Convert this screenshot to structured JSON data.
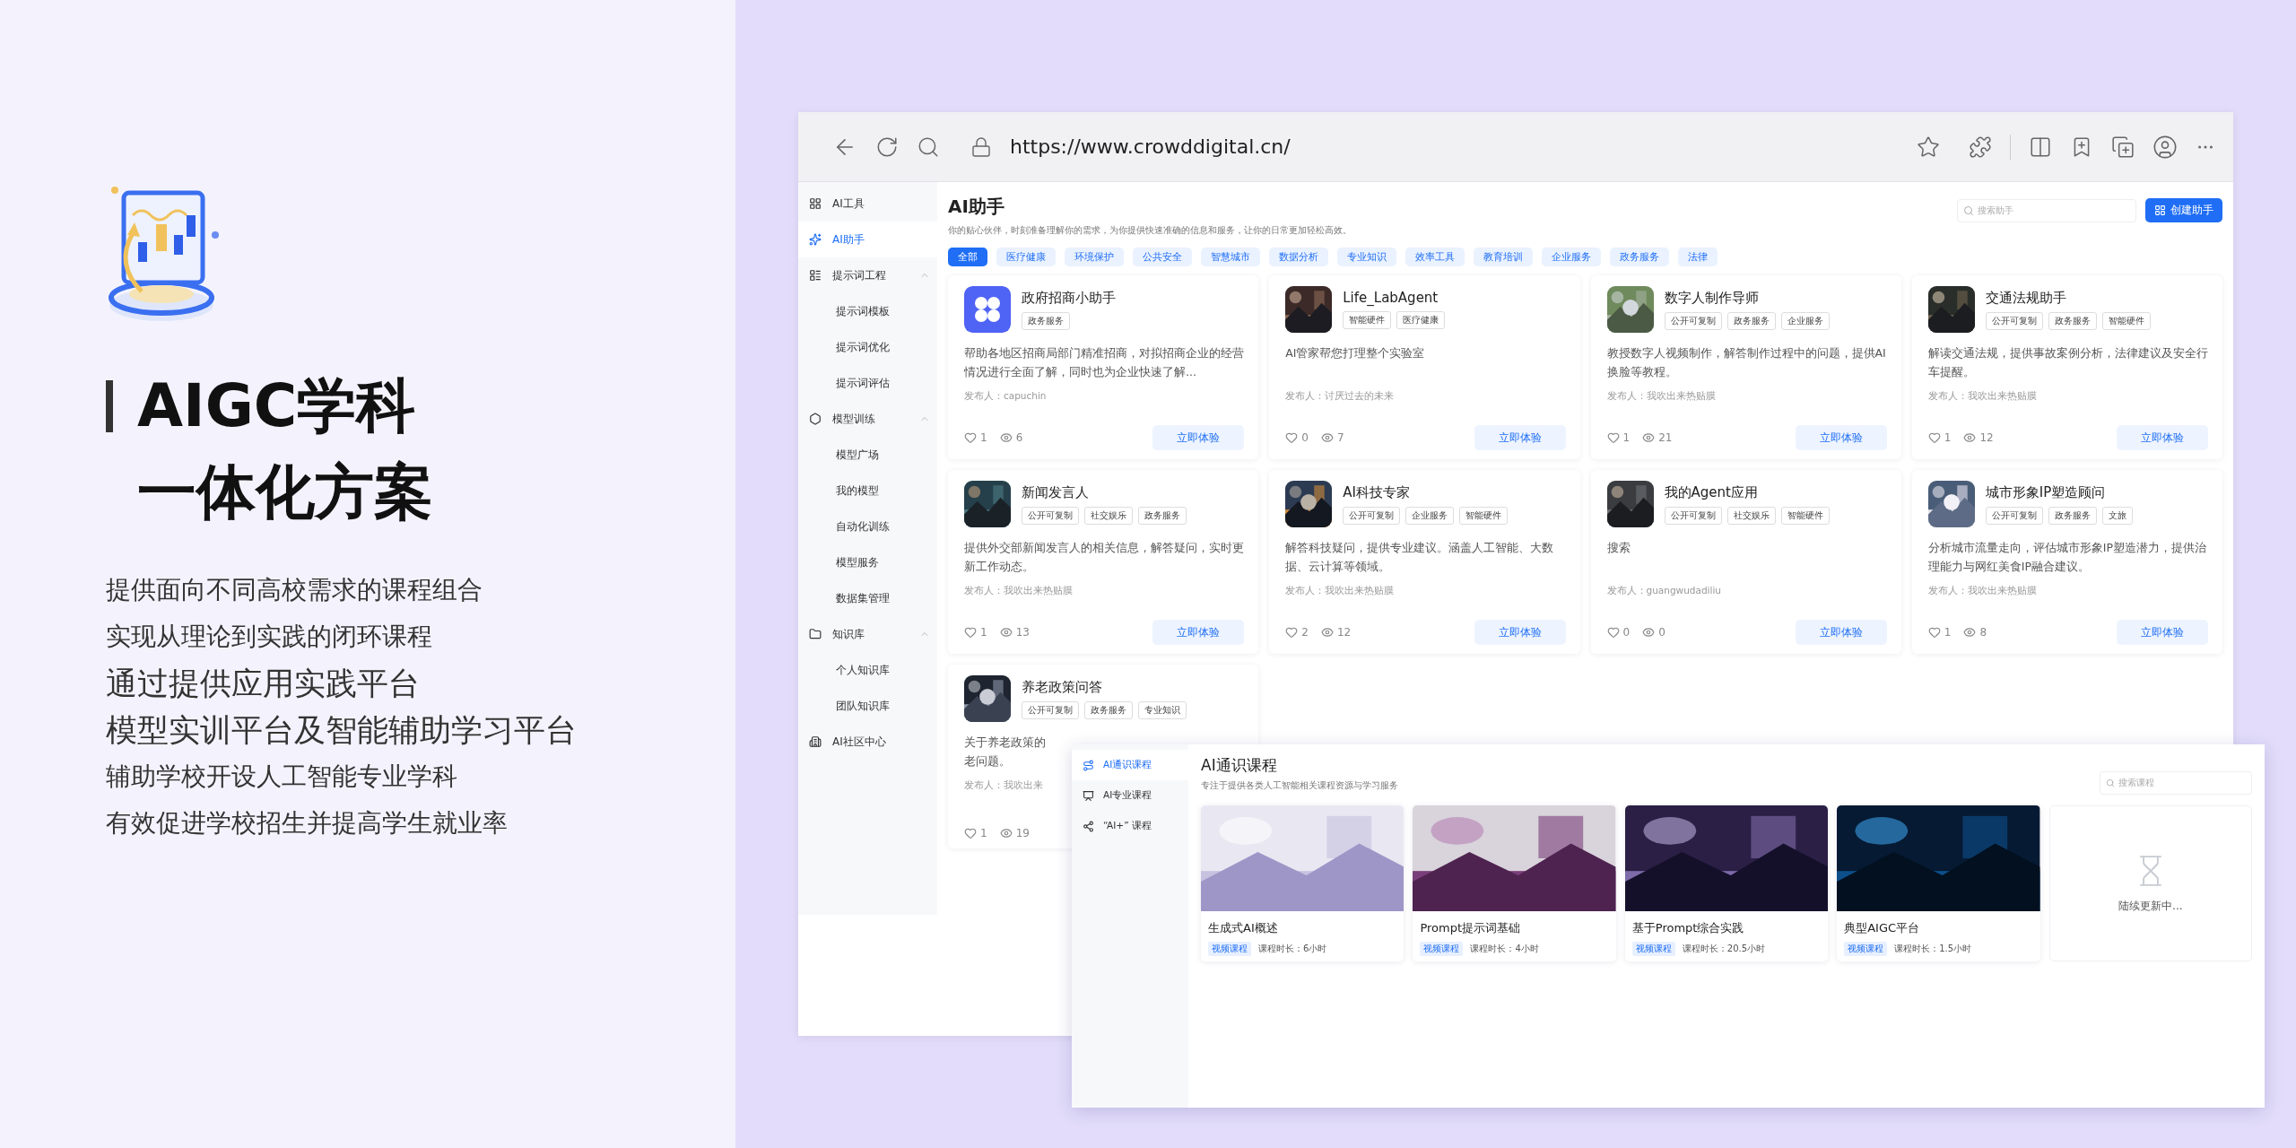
{
  "hero": {
    "title_lines": [
      "AIGC学科",
      "一体化方案"
    ],
    "bullets": [
      {
        "text": "提供面向不同高校需求的课程组合",
        "kind": "small"
      },
      {
        "text": "实现从理论到实践的闭环课程",
        "kind": "small"
      },
      {
        "text": "通过提供应用实践平台",
        "kind": "large"
      },
      {
        "text": "模型实训平台及智能辅助学习平台",
        "kind": "large"
      },
      {
        "text": "辅助学校开设人工智能专业学科",
        "kind": "small"
      },
      {
        "text": "有效促进学校招生并提高学生就业率",
        "kind": "small"
      }
    ]
  },
  "browser": {
    "url": "https://www.crowddigital.cn/"
  },
  "sidebar": {
    "items": [
      {
        "label": "AI工具",
        "selected": false
      },
      {
        "label": "AI助手",
        "selected": true
      },
      {
        "label": "提示词工程",
        "selected": false,
        "expanded": true,
        "children": [
          {
            "label": "提示词模板",
            "selected": false
          },
          {
            "label": "提示词优化",
            "selected": false
          },
          {
            "label": "提示词评估",
            "selected": false
          }
        ]
      },
      {
        "label": "模型训练",
        "selected": false,
        "expanded": true,
        "children": [
          {
            "label": "模型广场",
            "selected": false
          },
          {
            "label": "我的模型",
            "selected": false
          },
          {
            "label": "自动化训练",
            "selected": false
          },
          {
            "label": "模型服务",
            "selected": false
          },
          {
            "label": "数据集管理",
            "selected": false
          }
        ]
      },
      {
        "label": "知识库",
        "selected": false,
        "expanded": true,
        "children": [
          {
            "label": "个人知识库",
            "selected": false
          },
          {
            "label": "团队知识库",
            "selected": false
          }
        ]
      },
      {
        "label": "AI社区中心",
        "selected": false
      }
    ]
  },
  "page": {
    "title": "AI助手",
    "subtitle": "你的贴心伙伴，时刻准备理解你的需求，为你提供快速准确的信息和服务，让你的日常更加轻松高效。",
    "search_placeholder": "搜索助手",
    "create_button": "创建助手"
  },
  "filters": [
    {
      "label": "全部",
      "selected": true
    },
    {
      "label": "医疗健康",
      "selected": false
    },
    {
      "label": "环境保护",
      "selected": false
    },
    {
      "label": "公共安全",
      "selected": false
    },
    {
      "label": "智慧城市",
      "selected": false
    },
    {
      "label": "数据分析",
      "selected": false
    },
    {
      "label": "专业知识",
      "selected": false
    },
    {
      "label": "效率工具",
      "selected": false
    },
    {
      "label": "教育培训",
      "selected": false
    },
    {
      "label": "企业服务",
      "selected": false
    },
    {
      "label": "政务服务",
      "selected": false
    },
    {
      "label": "法律",
      "selected": false
    }
  ],
  "cards": [
    {
      "kind": "icon",
      "title": "政府招商小助手",
      "tags": [
        "政务服务"
      ],
      "desc": "帮助各地区招商局部门精准招商，对拟招商企业的经营情况进行全面了解，同时也为企业快速了解...",
      "author": "发布人：capuchin",
      "likes": "1",
      "views": "6",
      "button": "立即体验"
    },
    {
      "kind": "picture",
      "title": "Life_LabAgent",
      "tags": [
        "智能硬件",
        "医疗健康"
      ],
      "desc": "AI管家帮您打理整个实验室",
      "author": "发布人：讨厌过去的未来",
      "likes": "0",
      "views": "7",
      "button": "立即体验"
    },
    {
      "kind": "picture",
      "title": "数字人制作导师",
      "tags": [
        "公开可复制",
        "政务服务",
        "企业服务"
      ],
      "desc": "教授数字人视频制作，解答制作过程中的问题，提供AI换脸等教程。",
      "author": "发布人：我吹出来热贴膜",
      "likes": "1",
      "views": "21",
      "button": "立即体验"
    },
    {
      "kind": "picture",
      "title": "交通法规助手",
      "tags": [
        "公开可复制",
        "政务服务",
        "智能硬件"
      ],
      "desc": "解读交通法规，提供事故案例分析，法律建议及安全行车提醒。",
      "author": "发布人：我吹出来热贴膜",
      "likes": "1",
      "views": "12",
      "button": "立即体验"
    },
    {
      "kind": "picture",
      "title": "新闻发言人",
      "tags": [
        "公开可复制",
        "社交娱乐",
        "政务服务"
      ],
      "desc": "提供外交部新闻发言人的相关信息，解答疑问，实时更新工作动态。",
      "author": "发布人：我吹出来热贴膜",
      "likes": "1",
      "views": "13",
      "button": "立即体验"
    },
    {
      "kind": "picture",
      "title": "AI科技专家",
      "tags": [
        "公开可复制",
        "企业服务",
        "智能硬件"
      ],
      "desc": "解答科技疑问，提供专业建议。涵盖人工智能、大数据、云计算等领域。",
      "author": "发布人：我吹出来热贴膜",
      "likes": "2",
      "views": "12",
      "button": "立即体验"
    },
    {
      "kind": "picture",
      "title": "我的Agent应用",
      "tags": [
        "公开可复制",
        "社交娱乐",
        "智能硬件"
      ],
      "desc": "搜索",
      "author": "发布人：guangwudadiliu",
      "likes": "0",
      "views": "0",
      "button": "立即体验"
    },
    {
      "kind": "picture",
      "title": "城市形象IP塑造顾问",
      "tags": [
        "公开可复制",
        "政务服务",
        "文旅"
      ],
      "desc": "分析城市流量走向，评估城市形象IP塑造潜力，提供治理能力与网红美食IP融合建议。",
      "author": "发布人：我吹出来热贴膜",
      "likes": "1",
      "views": "8",
      "button": "立即体验"
    },
    {
      "kind": "picture",
      "title": "养老政策问答",
      "tags": [
        "公开可复制",
        "政务服务",
        "专业知识"
      ],
      "desc_lines": [
        "关于养老政策的",
        "老问题。"
      ],
      "author": "发布人：我吹出来",
      "likes": "1",
      "views": "19"
    }
  ],
  "course_window": {
    "sidebar": [
      {
        "label": "AI通识课程",
        "selected": true
      },
      {
        "label": "AI专业课程",
        "selected": false
      },
      {
        "label": "“AI+” 课程",
        "selected": false
      }
    ],
    "title": "AI通识课程",
    "subtitle": "专注于提供各类人工智能相关课程资源与学习服务",
    "search_placeholder": "搜索课程",
    "courses": [
      {
        "kind": "course",
        "title": "生成式AI概述",
        "tag": "视频课程",
        "duration": "课程时长：6小时"
      },
      {
        "kind": "course",
        "title": "Prompt提示词基础",
        "tag": "视频课程",
        "duration": "课程时长：4小时"
      },
      {
        "kind": "course",
        "title": "基于Prompt综合实践",
        "tag": "视频课程",
        "duration": "课程时长：20.5小时"
      },
      {
        "kind": "course",
        "title": "典型AIGC平台",
        "tag": "视频课程",
        "duration": "课程时长：1.5小时"
      },
      {
        "kind": "placeholder",
        "text": "陆续更新中..."
      }
    ]
  }
}
